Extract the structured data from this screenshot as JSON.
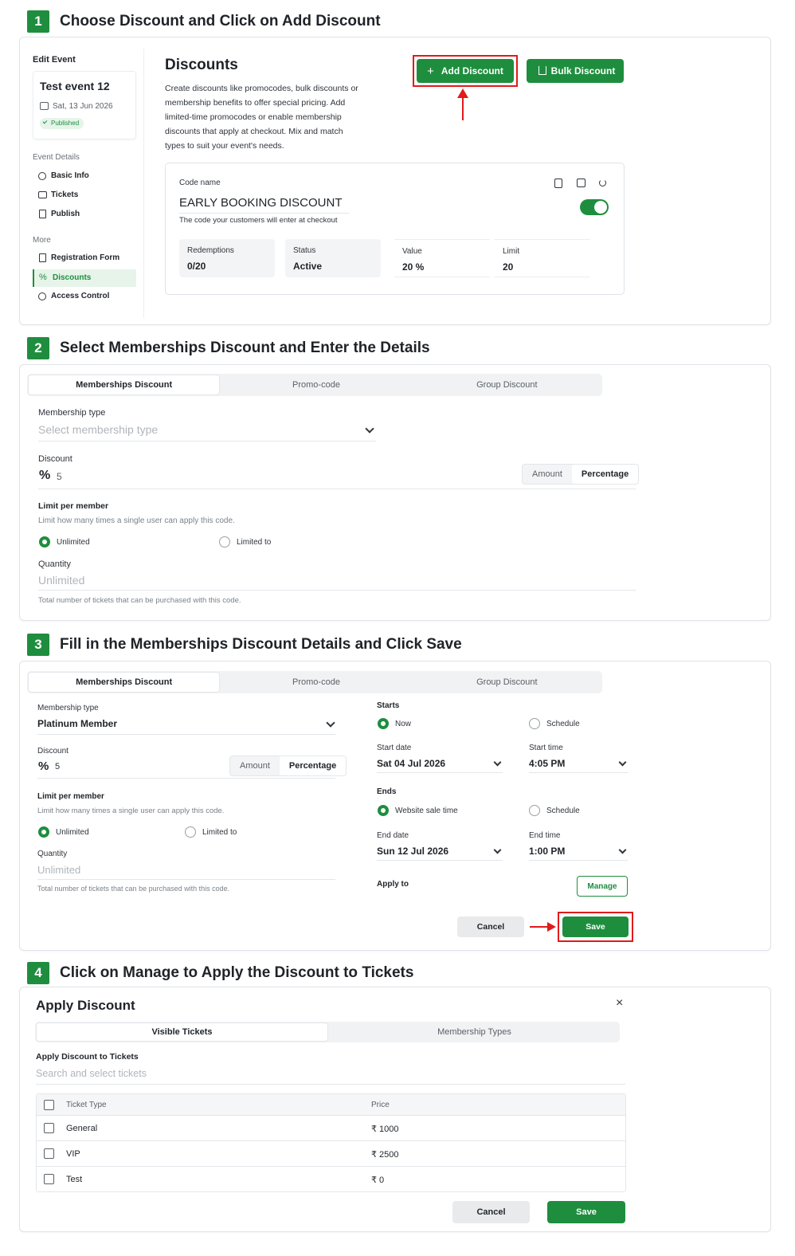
{
  "steps": [
    {
      "num": "1",
      "title": "Choose Discount and Click on Add Discount"
    },
    {
      "num": "2",
      "title": "Select Memberships Discount and Enter the Details"
    },
    {
      "num": "3",
      "title": "Fill in the Memberships Discount Details and Click Save"
    },
    {
      "num": "4",
      "title": "Click on Manage to Apply the Discount to Tickets"
    }
  ],
  "sidebar": {
    "edit_event": "Edit Event",
    "event_name": "Test event 12",
    "event_date": "Sat, 13 Jun 2026",
    "status_badge": "Published",
    "section_details": "Event Details",
    "details_items": [
      "Basic Info",
      "Tickets",
      "Publish"
    ],
    "section_more": "More",
    "more_items": [
      "Registration Form",
      "Discounts",
      "Access Control"
    ]
  },
  "discounts": {
    "title": "Discounts",
    "description": [
      "Create discounts like promocodes, bulk discounts or",
      "membership benefits to offer special pricing. Add",
      "limited-time promocodes or enable membership",
      "discounts that apply at checkout. Mix and match",
      "types to suit your event's needs."
    ],
    "add_button": "Add Discount",
    "bulk_button": "Bulk Discount",
    "code_label": "Code name",
    "code_name": "EARLY BOOKING DISCOUNT",
    "code_hint": "The code your customers will enter at checkout",
    "stats": [
      {
        "label": "Redemptions",
        "value": "0/20"
      },
      {
        "label": "Status",
        "value": "Active"
      },
      {
        "label": "Value",
        "value": "20 %"
      },
      {
        "label": "Limit",
        "value": "20"
      }
    ]
  },
  "tabs": [
    "Memberships Discount",
    "Promo-code",
    "Group Discount"
  ],
  "form2": {
    "membership_label": "Membership type",
    "membership_placeholder": "Select membership type",
    "discount_label": "Discount",
    "discount_symbol": "%",
    "discount_value": "5",
    "seg_amount": "Amount",
    "seg_percentage": "Percentage",
    "limit_label": "Limit per member",
    "limit_hint": "Limit how many times a single user can apply this code.",
    "unlimited": "Unlimited",
    "limited_to": "Limited to",
    "quantity_label": "Quantity",
    "quantity_placeholder": "Unlimited",
    "quantity_hint": "Total number of tickets that can be purchased with this code."
  },
  "form3": {
    "membership_value": "Platinum Member",
    "starts_label": "Starts",
    "now": "Now",
    "schedule": "Schedule",
    "start_date_label": "Start date",
    "start_date": "Sat 04 Jul 2026",
    "start_time_label": "Start time",
    "start_time": "4:05 PM",
    "ends_label": "Ends",
    "website_sale_time": "Website sale time",
    "end_date_label": "End date",
    "end_date": "Sun 12 Jul 2026",
    "end_time_label": "End time",
    "end_time": "1:00 PM",
    "apply_to_label": "Apply to",
    "manage_button": "Manage",
    "cancel_button": "Cancel",
    "save_button": "Save"
  },
  "apply": {
    "title": "Apply Discount",
    "tabs": [
      "Visible Tickets",
      "Membership Types"
    ],
    "section_label": "Apply Discount to Tickets",
    "search_placeholder": "Search and select tickets",
    "col_ticket": "Ticket Type",
    "col_price": "Price",
    "rows": [
      {
        "name": "General",
        "price": "₹ 1000"
      },
      {
        "name": "VIP",
        "price": "₹ 2500"
      },
      {
        "name": "Test",
        "price": "₹ 0"
      }
    ],
    "cancel_button": "Cancel",
    "save_button": "Save"
  },
  "colors": {
    "accent": "#1e8e3e",
    "highlight": "#e01b1b"
  }
}
